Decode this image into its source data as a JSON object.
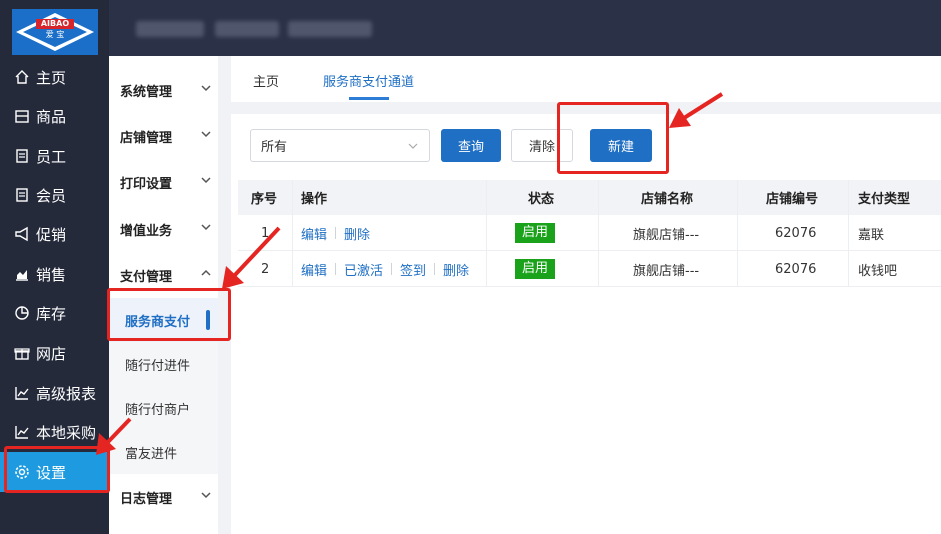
{
  "logo": {
    "brand": "AIBAO",
    "brand_cn": "爱 宝"
  },
  "rail": [
    {
      "label": "主页",
      "icon": "home-icon"
    },
    {
      "label": "商品",
      "icon": "goods-icon"
    },
    {
      "label": "员工",
      "icon": "staff-icon"
    },
    {
      "label": "会员",
      "icon": "member-icon"
    },
    {
      "label": "促销",
      "icon": "promo-icon"
    },
    {
      "label": "销售",
      "icon": "sales-icon"
    },
    {
      "label": "库存",
      "icon": "stock-icon"
    },
    {
      "label": "网店",
      "icon": "shop-icon"
    },
    {
      "label": "高级报表",
      "icon": "report-icon"
    },
    {
      "label": "本地采购",
      "icon": "purchase-icon"
    },
    {
      "label": "设置",
      "icon": "gear-icon"
    }
  ],
  "subnav": {
    "groups": [
      "系统管理",
      "店铺管理",
      "打印设置",
      "增值业务",
      "支付管理"
    ],
    "items": [
      "服务商支付",
      "随行付进件",
      "随行付商户",
      "富友进件"
    ],
    "last_group": "日志管理"
  },
  "tabs": [
    "主页",
    "服务商支付通道"
  ],
  "filter": {
    "select_value": "所有",
    "query": "查询",
    "clear": "清除",
    "create": "新建"
  },
  "table": {
    "headers": [
      "序号",
      "操作",
      "状态",
      "店铺名称",
      "店铺编号",
      "支付类型"
    ],
    "rows": [
      {
        "no": "1",
        "ops": [
          "编辑",
          "删除"
        ],
        "status": "启用",
        "name": "旗舰店铺---",
        "code": "62076",
        "type": "嘉联"
      },
      {
        "no": "2",
        "ops": [
          "编辑",
          "已激活",
          "签到",
          "删除"
        ],
        "status": "启用",
        "name": "旗舰店铺---",
        "code": "62076",
        "type": "收钱吧"
      }
    ]
  },
  "colors": {
    "accent": "#1f6fc4",
    "rail_bg": "#252a3b",
    "active_rail": "#1e9be0",
    "status_green": "#1aa31a",
    "annotation_red": "#e52521"
  }
}
